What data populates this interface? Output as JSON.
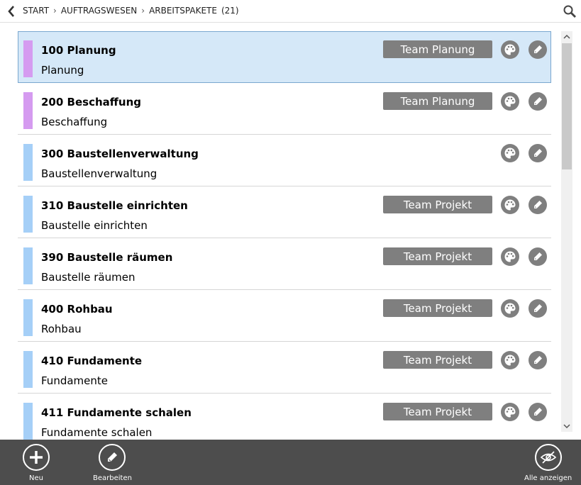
{
  "header": {
    "breadcrumb": [
      "START",
      "AUFTRAGSWESEN",
      "ARBEITSPAKETE"
    ],
    "count": "(21)"
  },
  "rows": [
    {
      "title": "100 Planung",
      "subtitle": "Planung",
      "team": "Team Planung",
      "color": "#d59bf0",
      "selected": true
    },
    {
      "title": "200 Beschaffung",
      "subtitle": "Beschaffung",
      "team": "Team Planung",
      "color": "#d59bf0",
      "selected": false
    },
    {
      "title": "300 Baustellenverwaltung",
      "subtitle": "Baustellenverwaltung",
      "team": "",
      "color": "#a5cff7",
      "selected": false
    },
    {
      "title": "310 Baustelle einrichten",
      "subtitle": "Baustelle einrichten",
      "team": "Team Projekt",
      "color": "#a5cff7",
      "selected": false
    },
    {
      "title": "390 Baustelle räumen",
      "subtitle": "Baustelle räumen",
      "team": "Team Projekt",
      "color": "#a5cff7",
      "selected": false
    },
    {
      "title": "400 Rohbau",
      "subtitle": "Rohbau",
      "team": "Team Projekt",
      "color": "#a5cff7",
      "selected": false
    },
    {
      "title": "410 Fundamente",
      "subtitle": "Fundamente",
      "team": "Team Projekt",
      "color": "#a5cff7",
      "selected": false
    },
    {
      "title": "411 Fundamente schalen",
      "subtitle": "Fundamente schalen",
      "team": "Team Projekt",
      "color": "#a5cff7",
      "selected": false
    }
  ],
  "footer": {
    "new_label": "Neu",
    "edit_label": "Bearbeiten",
    "show_all_label": "Alle anzeigen"
  },
  "icons": {
    "back": "chevron-left-icon",
    "search": "search-icon",
    "palette": "palette-icon",
    "edit": "pencil-icon",
    "new": "plus-icon",
    "show_all": "eye-slash-icon"
  },
  "colors": {
    "selection_bg": "#d5e8f8",
    "team_badge": "#7f7f7f",
    "footer_bg": "#4d4d4d"
  }
}
